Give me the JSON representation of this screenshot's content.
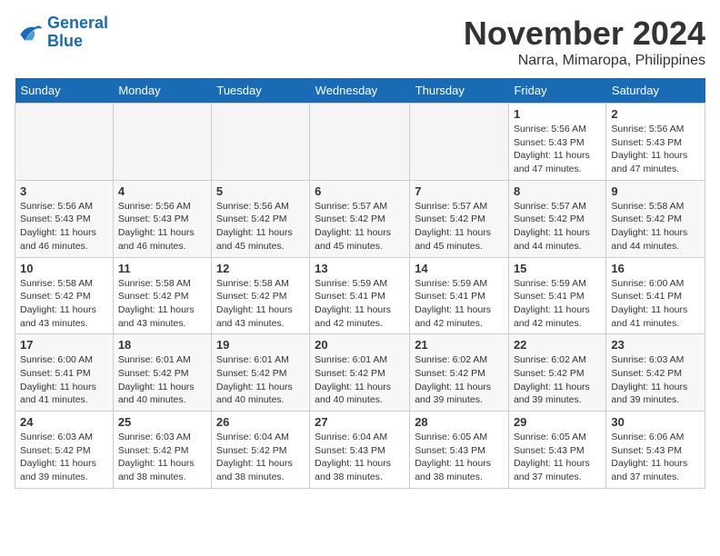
{
  "logo": {
    "general": "General",
    "blue": "Blue"
  },
  "title": "November 2024",
  "location": "Narra, Mimaropa, Philippines",
  "headers": [
    "Sunday",
    "Monday",
    "Tuesday",
    "Wednesday",
    "Thursday",
    "Friday",
    "Saturday"
  ],
  "weeks": [
    [
      {
        "day": "",
        "info": ""
      },
      {
        "day": "",
        "info": ""
      },
      {
        "day": "",
        "info": ""
      },
      {
        "day": "",
        "info": ""
      },
      {
        "day": "",
        "info": ""
      },
      {
        "day": "1",
        "info": "Sunrise: 5:56 AM\nSunset: 5:43 PM\nDaylight: 11 hours and 47 minutes."
      },
      {
        "day": "2",
        "info": "Sunrise: 5:56 AM\nSunset: 5:43 PM\nDaylight: 11 hours and 47 minutes."
      }
    ],
    [
      {
        "day": "3",
        "info": "Sunrise: 5:56 AM\nSunset: 5:43 PM\nDaylight: 11 hours and 46 minutes."
      },
      {
        "day": "4",
        "info": "Sunrise: 5:56 AM\nSunset: 5:43 PM\nDaylight: 11 hours and 46 minutes."
      },
      {
        "day": "5",
        "info": "Sunrise: 5:56 AM\nSunset: 5:42 PM\nDaylight: 11 hours and 45 minutes."
      },
      {
        "day": "6",
        "info": "Sunrise: 5:57 AM\nSunset: 5:42 PM\nDaylight: 11 hours and 45 minutes."
      },
      {
        "day": "7",
        "info": "Sunrise: 5:57 AM\nSunset: 5:42 PM\nDaylight: 11 hours and 45 minutes."
      },
      {
        "day": "8",
        "info": "Sunrise: 5:57 AM\nSunset: 5:42 PM\nDaylight: 11 hours and 44 minutes."
      },
      {
        "day": "9",
        "info": "Sunrise: 5:58 AM\nSunset: 5:42 PM\nDaylight: 11 hours and 44 minutes."
      }
    ],
    [
      {
        "day": "10",
        "info": "Sunrise: 5:58 AM\nSunset: 5:42 PM\nDaylight: 11 hours and 43 minutes."
      },
      {
        "day": "11",
        "info": "Sunrise: 5:58 AM\nSunset: 5:42 PM\nDaylight: 11 hours and 43 minutes."
      },
      {
        "day": "12",
        "info": "Sunrise: 5:58 AM\nSunset: 5:42 PM\nDaylight: 11 hours and 43 minutes."
      },
      {
        "day": "13",
        "info": "Sunrise: 5:59 AM\nSunset: 5:41 PM\nDaylight: 11 hours and 42 minutes."
      },
      {
        "day": "14",
        "info": "Sunrise: 5:59 AM\nSunset: 5:41 PM\nDaylight: 11 hours and 42 minutes."
      },
      {
        "day": "15",
        "info": "Sunrise: 5:59 AM\nSunset: 5:41 PM\nDaylight: 11 hours and 42 minutes."
      },
      {
        "day": "16",
        "info": "Sunrise: 6:00 AM\nSunset: 5:41 PM\nDaylight: 11 hours and 41 minutes."
      }
    ],
    [
      {
        "day": "17",
        "info": "Sunrise: 6:00 AM\nSunset: 5:41 PM\nDaylight: 11 hours and 41 minutes."
      },
      {
        "day": "18",
        "info": "Sunrise: 6:01 AM\nSunset: 5:42 PM\nDaylight: 11 hours and 40 minutes."
      },
      {
        "day": "19",
        "info": "Sunrise: 6:01 AM\nSunset: 5:42 PM\nDaylight: 11 hours and 40 minutes."
      },
      {
        "day": "20",
        "info": "Sunrise: 6:01 AM\nSunset: 5:42 PM\nDaylight: 11 hours and 40 minutes."
      },
      {
        "day": "21",
        "info": "Sunrise: 6:02 AM\nSunset: 5:42 PM\nDaylight: 11 hours and 39 minutes."
      },
      {
        "day": "22",
        "info": "Sunrise: 6:02 AM\nSunset: 5:42 PM\nDaylight: 11 hours and 39 minutes."
      },
      {
        "day": "23",
        "info": "Sunrise: 6:03 AM\nSunset: 5:42 PM\nDaylight: 11 hours and 39 minutes."
      }
    ],
    [
      {
        "day": "24",
        "info": "Sunrise: 6:03 AM\nSunset: 5:42 PM\nDaylight: 11 hours and 39 minutes."
      },
      {
        "day": "25",
        "info": "Sunrise: 6:03 AM\nSunset: 5:42 PM\nDaylight: 11 hours and 38 minutes."
      },
      {
        "day": "26",
        "info": "Sunrise: 6:04 AM\nSunset: 5:42 PM\nDaylight: 11 hours and 38 minutes."
      },
      {
        "day": "27",
        "info": "Sunrise: 6:04 AM\nSunset: 5:43 PM\nDaylight: 11 hours and 38 minutes."
      },
      {
        "day": "28",
        "info": "Sunrise: 6:05 AM\nSunset: 5:43 PM\nDaylight: 11 hours and 38 minutes."
      },
      {
        "day": "29",
        "info": "Sunrise: 6:05 AM\nSunset: 5:43 PM\nDaylight: 11 hours and 37 minutes."
      },
      {
        "day": "30",
        "info": "Sunrise: 6:06 AM\nSunset: 5:43 PM\nDaylight: 11 hours and 37 minutes."
      }
    ]
  ]
}
